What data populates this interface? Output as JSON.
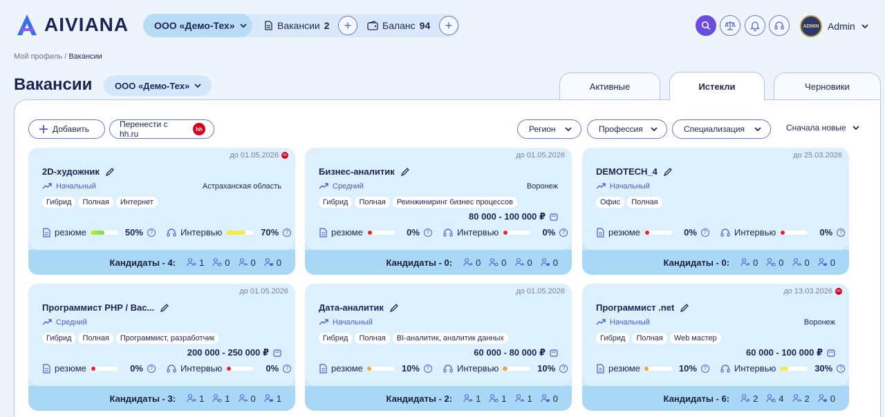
{
  "app": {
    "logo_text": "AIVIANA"
  },
  "topbar": {
    "company": "ООО «Демо-Тех»",
    "vacancies_label": "Вакансии",
    "vacancies_count": "2",
    "balance_label": "Баланс",
    "balance_value": "94",
    "user_name": "Admin",
    "avatar_text": "ADMIN"
  },
  "breadcrumb": {
    "root": "Мой профиль",
    "sep": " / ",
    "current": "Вакансии"
  },
  "page": {
    "title": "Вакансии",
    "company": "ООО «Демо-Тех»"
  },
  "tabs": [
    {
      "label": "Активные"
    },
    {
      "label": "Истекли"
    },
    {
      "label": "Черновики"
    }
  ],
  "toolbar": {
    "add_label": "Добавить",
    "import_label": "Перенести с hh.ru",
    "hh_badge": "hh",
    "filters": [
      "Регион",
      "Профессия",
      "Специализация"
    ],
    "sort_label": "Сначала новые"
  },
  "labels": {
    "resume": "резюме",
    "interview": "Интервью",
    "candidates_prefix": "Кандидаты - "
  },
  "colors": {
    "accent": "#6676d8",
    "brand": "#1c2456",
    "red": "#e8212b",
    "orange": "#f5a033",
    "green": "#7ed957",
    "yellow": "#f4ea4a"
  },
  "cards": [
    {
      "date": "до 01.05.2026",
      "hh": true,
      "title": "2D-художник",
      "level": "Начальный",
      "region": "Астраханская область",
      "tags": [
        "Гибрид",
        "Полная",
        "Интернет"
      ],
      "salary": "",
      "resume_pct": "50%",
      "resume_level": 0.5,
      "resume_color": "green",
      "interview_pct": "70%",
      "interview_level": 0.7,
      "interview_color": "yellow",
      "candidates": "4",
      "stats": [
        "1",
        "0",
        "0",
        "0"
      ]
    },
    {
      "date": "до 01.05.2026",
      "hh": false,
      "title": "Бизнес-аналитик",
      "level": "Средний",
      "region": "Воронеж",
      "tags": [
        "Гибрид",
        "Полная",
        "Реинжиниринг бизнес процессов"
      ],
      "salary": "80 000 - 100 000 ₽",
      "resume_pct": "0%",
      "resume_level": 0,
      "resume_color": "red",
      "interview_pct": "0%",
      "interview_level": 0,
      "interview_color": "red",
      "candidates": "0",
      "stats": [
        "0",
        "0",
        "0",
        "0"
      ]
    },
    {
      "date": "до 25.03.2026",
      "hh": false,
      "title": "DEMOTECH_4",
      "level": "Начальный",
      "region": "",
      "tags": [
        "Офис",
        "Полная"
      ],
      "salary": "",
      "resume_pct": "0%",
      "resume_level": 0,
      "resume_color": "red",
      "interview_pct": "0%",
      "interview_level": 0,
      "interview_color": "red",
      "candidates": "0",
      "stats": [
        "0",
        "0",
        "0",
        "0"
      ]
    },
    {
      "date": "до 01.05.2026",
      "hh": false,
      "title": "Программист PHP / Вас...",
      "level": "Средний",
      "region": "",
      "tags": [
        "Гибрид",
        "Полная",
        "Программист, разработчик"
      ],
      "salary": "200 000 - 250 000 ₽",
      "resume_pct": "0%",
      "resume_level": 0,
      "resume_color": "red",
      "interview_pct": "0%",
      "interview_level": 0,
      "interview_color": "red",
      "candidates": "3",
      "stats": [
        "1",
        "1",
        "0",
        "1"
      ]
    },
    {
      "date": "до 01.05.2026",
      "hh": false,
      "title": "Дата-аналитик",
      "level": "Начальный",
      "region": "",
      "tags": [
        "Гибрид",
        "Полная",
        "BI-аналитик, аналитик данных"
      ],
      "salary": "60 000 - 80 000 ₽",
      "resume_pct": "10%",
      "resume_level": 0.1,
      "resume_color": "orange",
      "interview_pct": "10%",
      "interview_level": 0.1,
      "interview_color": "orange",
      "candidates": "2",
      "stats": [
        "1",
        "1",
        "1",
        "0"
      ]
    },
    {
      "date": "до 13.03.2026",
      "hh": true,
      "title": "Программист .net",
      "level": "Начальный",
      "region": "Воронеж",
      "tags": [
        "Гибрид",
        "Полная",
        "Web мастер"
      ],
      "salary": "60 000 - 100 000 ₽",
      "resume_pct": "10%",
      "resume_level": 0.1,
      "resume_color": "orange",
      "interview_pct": "30%",
      "interview_level": 0.3,
      "interview_color": "yellow",
      "candidates": "6",
      "stats": [
        "2",
        "4",
        "2",
        "0"
      ]
    }
  ]
}
